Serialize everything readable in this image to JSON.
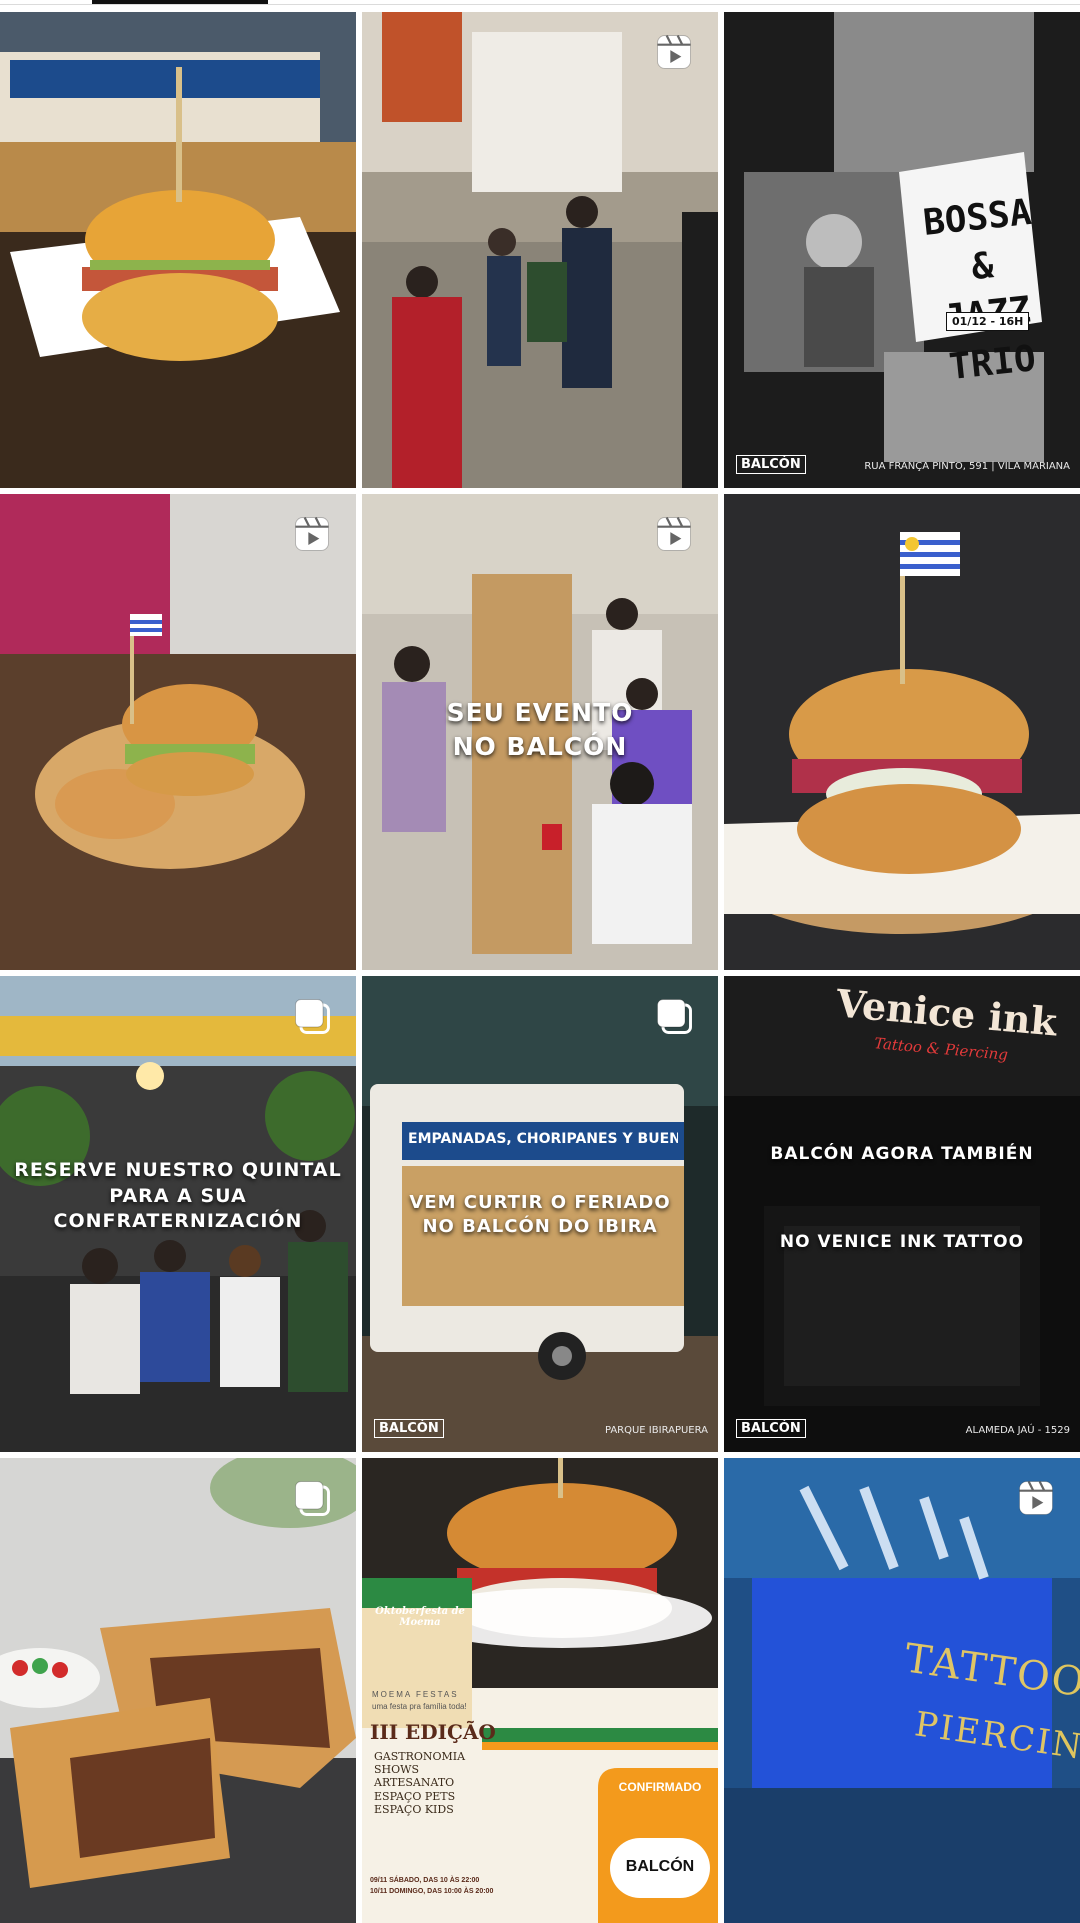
{
  "profile_tabs": {
    "active_index": 0
  },
  "posts": [
    {
      "type": "single",
      "kind": "food",
      "texts": {}
    },
    {
      "type": "reel",
      "kind": "crowd",
      "texts": {}
    },
    {
      "type": "single",
      "kind": "bw_poster",
      "texts": {
        "title_1": "BOSSA",
        "title_2": "& JAZZ",
        "title_3": "TRIO",
        "date": "01/12 - 16H",
        "brand": "BALCÓN",
        "location": "RUA FRANÇA PINTO, 591 | VILA MARIANA"
      }
    },
    {
      "type": "reel",
      "kind": "food",
      "texts": {}
    },
    {
      "type": "reel",
      "kind": "crowd",
      "texts": {
        "line_1": "SEU EVENTO",
        "line_2": "NO BALCÓN"
      }
    },
    {
      "type": "single",
      "kind": "food",
      "texts": {}
    },
    {
      "type": "carousel",
      "kind": "crowd",
      "texts": {
        "line_1": "RESERVE NUESTRO QUINTAL",
        "line_2": "PARA A SUA",
        "line_3": "CONFRATERNIZACIÓN"
      }
    },
    {
      "type": "carousel",
      "kind": "truck",
      "texts": {
        "line_1": "VEM CURTIR O FERIADO",
        "line_2": "NO BALCÓN DO IBIRA",
        "brand": "BALCÓN",
        "location": "PARQUE IBIRAPUERA",
        "truck_sign": "EMPANADAS, CHORIPANES Y BUENA ONDA"
      }
    },
    {
      "type": "single",
      "kind": "storefront",
      "texts": {
        "sign": "Venice ink",
        "sign_sub": "Tattoo & Piercing",
        "line_1": "BALCÓN AGORA TAMBIÉN",
        "line_2": "NO VENICE INK TATTOO",
        "brand": "BALCÓN",
        "location": "ALAMEDA JAÚ - 1529"
      }
    },
    {
      "type": "carousel",
      "kind": "empanada",
      "texts": {}
    },
    {
      "type": "single",
      "kind": "festival",
      "texts": {
        "festival_name": "Oktoberfesta de Moema",
        "subtitle": "MOEMA FESTAS",
        "tagline": "uma festa pra família toda!",
        "edition": "III EDIÇÃO",
        "items": [
          "GASTRONOMIA",
          "SHOWS",
          "ARTESANATO",
          "ESPAÇO PETS",
          "ESPAÇO KIDS"
        ],
        "dates_1": "09/11 SÁBADO, DAS 10 ÀS 22:00",
        "dates_2": "10/11 DOMINGO, DAS 10:00 ÀS 20:00",
        "confirmed": "CONFIRMADO",
        "brand": "BALCÓN"
      }
    },
    {
      "type": "reel",
      "kind": "neon",
      "texts": {
        "neon_1": "TATTOO",
        "neon_2": "PIERCING"
      }
    }
  ],
  "icons": {
    "reel": "reels-icon",
    "carousel": "carousel-icon"
  },
  "colors": {
    "tab_indicator": "#111111",
    "divider": "#dbdbdb",
    "festival_orange": "#f39a1c",
    "uruguay_blue": "#3a5fcd"
  }
}
